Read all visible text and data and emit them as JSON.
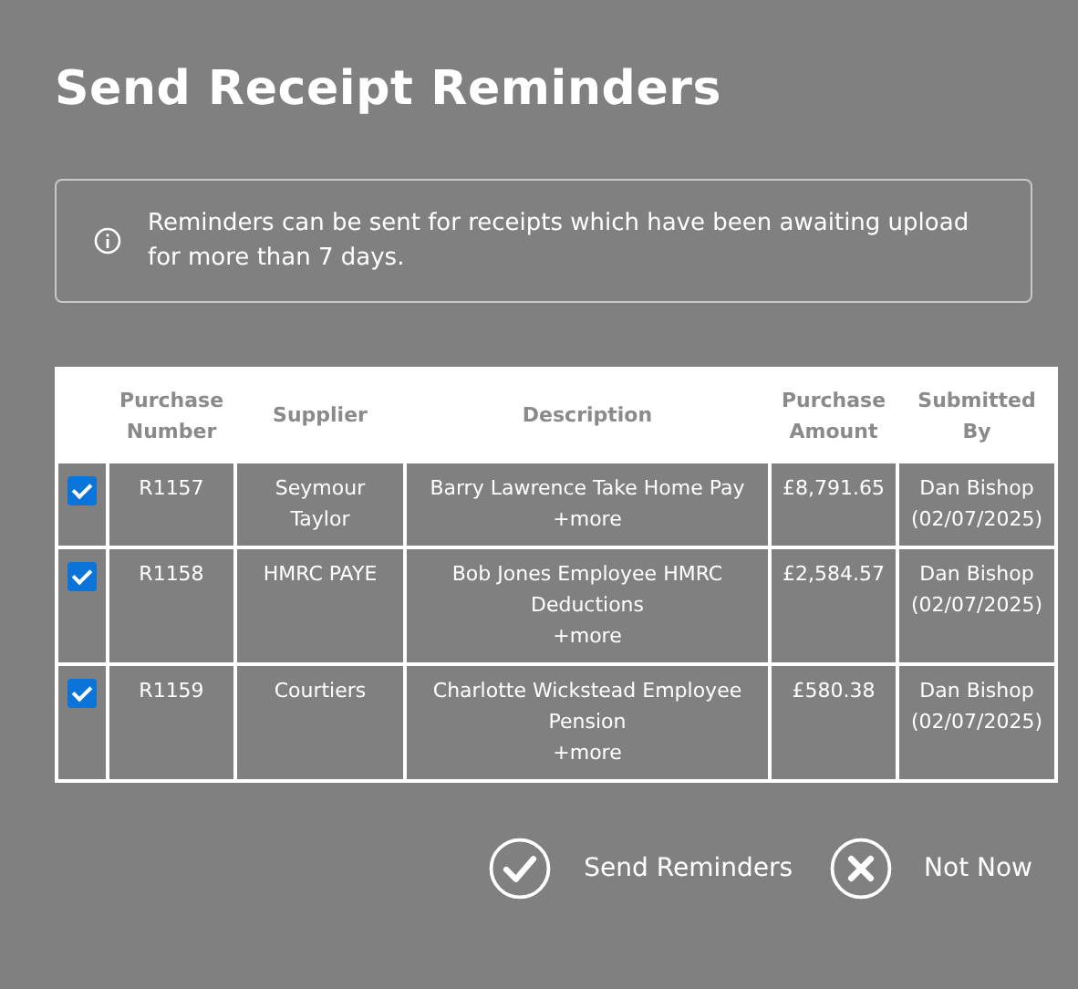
{
  "dialog": {
    "title": "Send Receipt Reminders"
  },
  "notice": {
    "text": "Reminders can be sent for receipts which have been awaiting upload for more than 7 days."
  },
  "table": {
    "columns": [
      "Purchase Number",
      "Supplier",
      "Description",
      "Purchase Amount",
      "Submitted By"
    ],
    "rows": [
      {
        "checked": true,
        "number": "R1157",
        "supplier": "Seymour Taylor",
        "description": "Barry Lawrence Take Home Pay",
        "more": "+more",
        "amount": "£8,791.65",
        "submitted_by": "Dan Bishop (02/07/2025)"
      },
      {
        "checked": true,
        "number": "R1158",
        "supplier": "HMRC PAYE",
        "description": "Bob Jones Employee HMRC Deductions",
        "more": "+more",
        "amount": "£2,584.57",
        "submitted_by": "Dan Bishop (02/07/2025)"
      },
      {
        "checked": true,
        "number": "R1159",
        "supplier": "Courtiers",
        "description": "Charlotte Wickstead Employee Pension",
        "more": "+more",
        "amount": "£580.38",
        "submitted_by": "Dan Bishop (02/07/2025)"
      }
    ]
  },
  "actions": [
    {
      "kind": "confirm",
      "label": "Send Reminders"
    },
    {
      "kind": "cancel",
      "label": "Not Now"
    }
  ]
}
